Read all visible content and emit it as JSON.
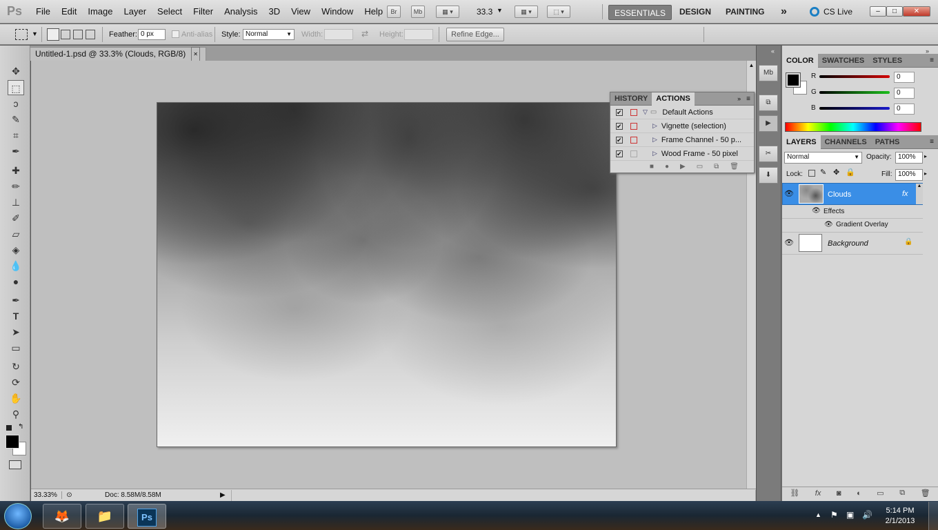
{
  "app": {
    "logo": "Ps"
  },
  "menu": [
    "File",
    "Edit",
    "Image",
    "Layer",
    "Select",
    "Filter",
    "Analysis",
    "3D",
    "View",
    "Window",
    "Help"
  ],
  "appbar": {
    "bridge": "Br",
    "minibridge": "Mb",
    "zoom": "33.3"
  },
  "workspaces": {
    "essentials": "ESSENTIALS",
    "design": "DESIGN",
    "painting": "PAINTING",
    "more": "»",
    "cslive": "CS Live"
  },
  "window_buttons": {
    "min": "–",
    "max": "□",
    "close": "✕"
  },
  "options": {
    "feather_label": "Feather:",
    "feather_value": "0 px",
    "antialias": "Anti-alias",
    "style_label": "Style:",
    "style_value": "Normal",
    "width_label": "Width:",
    "height_label": "Height:",
    "refine": "Refine Edge..."
  },
  "document": {
    "tab": "Untitled-1.psd @ 33.3% (Clouds, RGB/8)",
    "close": "✕"
  },
  "status": {
    "zoom": "33.33%",
    "doc": "Doc: 8.58M/8.58M"
  },
  "actions_panel": {
    "tabs": [
      "HISTORY",
      "ACTIONS"
    ],
    "set": "Default Actions",
    "items": [
      "Vignette (selection)",
      "Frame Channel - 50 p...",
      "Wood Frame - 50 pixel"
    ]
  },
  "color_panel": {
    "tabs": [
      "COLOR",
      "SWATCHES",
      "STYLES"
    ],
    "r_label": "R",
    "g_label": "G",
    "b_label": "B",
    "r": "0",
    "g": "0",
    "b": "0",
    "colors": {
      "r": "#d40000",
      "g": "#1cbf1c",
      "b": "#1a1acc"
    }
  },
  "layers_panel": {
    "tabs": [
      "LAYERS",
      "CHANNELS",
      "PATHS"
    ],
    "blend": "Normal",
    "opacity_label": "Opacity:",
    "opacity": "100%",
    "lock_label": "Lock:",
    "fill_label": "Fill:",
    "fill": "100%",
    "layers": [
      {
        "name": "Clouds",
        "fx": "fx"
      },
      {
        "name": "Effects"
      },
      {
        "name": "Gradient Overlay"
      },
      {
        "name": "Background"
      }
    ]
  },
  "taskbar": {
    "time": "5:14 PM",
    "date": "2/1/2013",
    "ps": "Ps"
  }
}
